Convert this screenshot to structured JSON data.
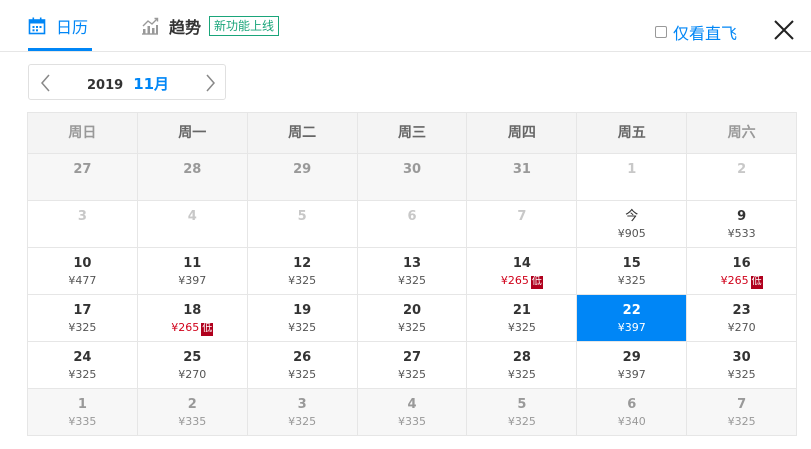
{
  "header": {
    "tabs": [
      {
        "label": "日历",
        "icon": "calendar-icon",
        "active": true
      },
      {
        "label": "趋势",
        "icon": "trend-chart-icon",
        "active": false,
        "badge": "新功能上线"
      }
    ],
    "direct_only_label": "仅看直飞",
    "direct_only_checked": false
  },
  "month_switcher": {
    "year": "2019",
    "month": "11月"
  },
  "calendar": {
    "weekdays": [
      "周日",
      "周一",
      "周二",
      "周三",
      "周四",
      "周五",
      "周六"
    ],
    "weeks": [
      [
        {
          "day": "27",
          "price": "",
          "state": "out"
        },
        {
          "day": "28",
          "price": "",
          "state": "out"
        },
        {
          "day": "29",
          "price": "",
          "state": "out"
        },
        {
          "day": "30",
          "price": "",
          "state": "out"
        },
        {
          "day": "31",
          "price": "",
          "state": "out"
        },
        {
          "day": "1",
          "price": "",
          "state": "past"
        },
        {
          "day": "2",
          "price": "",
          "state": "past"
        }
      ],
      [
        {
          "day": "3",
          "price": "",
          "state": "past"
        },
        {
          "day": "4",
          "price": "",
          "state": "past"
        },
        {
          "day": "5",
          "price": "",
          "state": "past"
        },
        {
          "day": "6",
          "price": "",
          "state": "past"
        },
        {
          "day": "7",
          "price": "",
          "state": "past"
        },
        {
          "day": "今",
          "price": "¥905",
          "state": "today"
        },
        {
          "day": "9",
          "price": "¥533",
          "state": "normal"
        }
      ],
      [
        {
          "day": "10",
          "price": "¥477",
          "state": "normal"
        },
        {
          "day": "11",
          "price": "¥397",
          "state": "normal"
        },
        {
          "day": "12",
          "price": "¥325",
          "state": "normal"
        },
        {
          "day": "13",
          "price": "¥325",
          "state": "normal"
        },
        {
          "day": "14",
          "price": "¥265",
          "state": "low"
        },
        {
          "day": "15",
          "price": "¥325",
          "state": "normal"
        },
        {
          "day": "16",
          "price": "¥265",
          "state": "low"
        }
      ],
      [
        {
          "day": "17",
          "price": "¥325",
          "state": "normal"
        },
        {
          "day": "18",
          "price": "¥265",
          "state": "low"
        },
        {
          "day": "19",
          "price": "¥325",
          "state": "normal"
        },
        {
          "day": "20",
          "price": "¥325",
          "state": "normal"
        },
        {
          "day": "21",
          "price": "¥325",
          "state": "normal"
        },
        {
          "day": "22",
          "price": "¥397",
          "state": "selected"
        },
        {
          "day": "23",
          "price": "¥270",
          "state": "normal"
        }
      ],
      [
        {
          "day": "24",
          "price": "¥325",
          "state": "normal"
        },
        {
          "day": "25",
          "price": "¥270",
          "state": "normal"
        },
        {
          "day": "26",
          "price": "¥325",
          "state": "normal"
        },
        {
          "day": "27",
          "price": "¥325",
          "state": "normal"
        },
        {
          "day": "28",
          "price": "¥325",
          "state": "normal"
        },
        {
          "day": "29",
          "price": "¥397",
          "state": "normal"
        },
        {
          "day": "30",
          "price": "¥325",
          "state": "normal"
        }
      ],
      [
        {
          "day": "1",
          "price": "¥335",
          "state": "out"
        },
        {
          "day": "2",
          "price": "¥335",
          "state": "out"
        },
        {
          "day": "3",
          "price": "¥325",
          "state": "out"
        },
        {
          "day": "4",
          "price": "¥335",
          "state": "out"
        },
        {
          "day": "5",
          "price": "¥325",
          "state": "out"
        },
        {
          "day": "6",
          "price": "¥340",
          "state": "out"
        },
        {
          "day": "7",
          "price": "¥325",
          "state": "out"
        }
      ]
    ],
    "low_tag": "低"
  },
  "colors": {
    "accent": "#0086f6",
    "low_price": "#d0021b",
    "badge_green": "#1aa57a"
  }
}
